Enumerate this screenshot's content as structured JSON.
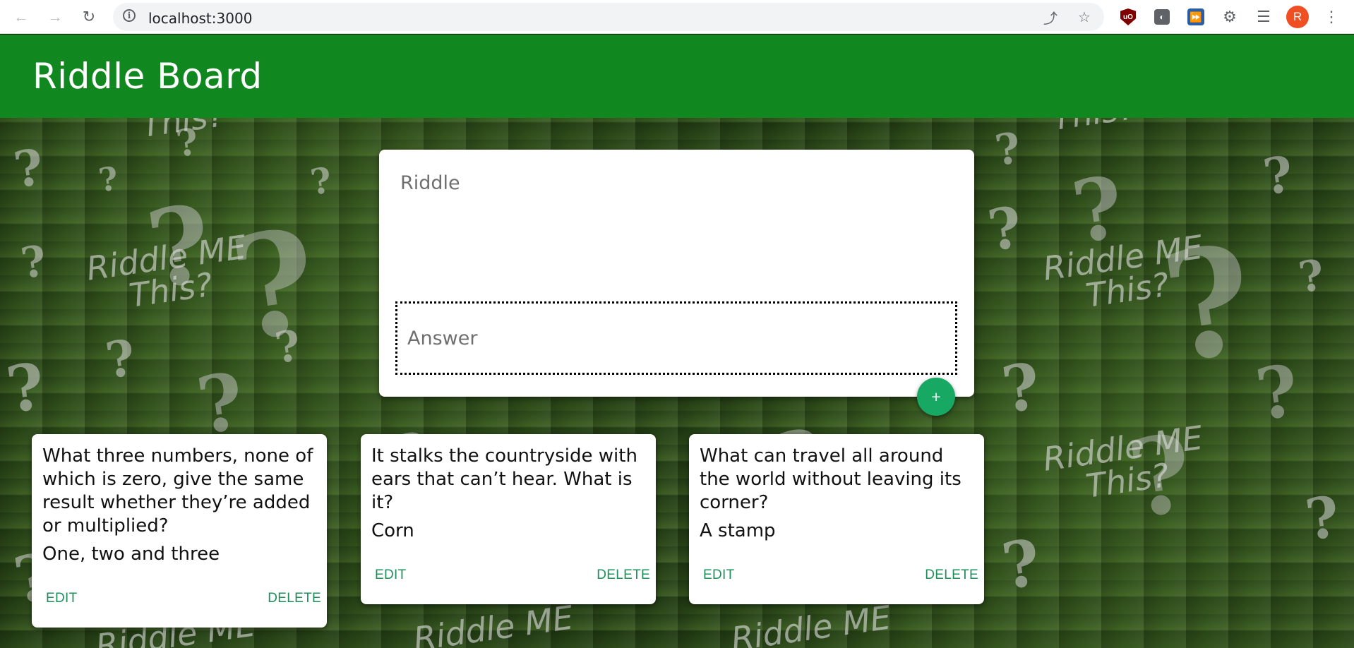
{
  "browser": {
    "url": "localhost:3000",
    "avatar_letter": "R",
    "ublock_label": "uO",
    "icons": [
      "back-icon",
      "forward-icon",
      "reload-icon",
      "info-icon",
      "share-icon",
      "star-icon",
      "ublock-icon",
      "extension-icon",
      "extension-icon",
      "puzzle-icon",
      "reading-list-icon",
      "avatar",
      "menu-icon"
    ]
  },
  "header": {
    "title": "Riddle Board"
  },
  "background": {
    "text_lines": [
      "Riddle ME",
      "This?"
    ],
    "text_riddle": "Riddle ME",
    "text_this": "This?"
  },
  "form": {
    "riddle_placeholder": "Riddle",
    "answer_placeholder": "Answer",
    "add_label": "+"
  },
  "cards": [
    {
      "question": "What three numbers, none of which is zero, give the same result whether they’re added or multiplied?",
      "answer": "One, two and three",
      "edit_label": "EDIT",
      "delete_label": "DELETE"
    },
    {
      "question": "It stalks the countryside with ears that can’t hear. What is it?",
      "answer": "Corn",
      "edit_label": "EDIT",
      "delete_label": "DELETE"
    },
    {
      "question": "What can travel all around the world without leaving its corner?",
      "answer": "A stamp",
      "edit_label": "EDIT",
      "delete_label": "DELETE"
    }
  ],
  "colors": {
    "header_bg": "#11871f",
    "accent_green": "#1e8f5a",
    "add_button": "#17a864"
  }
}
